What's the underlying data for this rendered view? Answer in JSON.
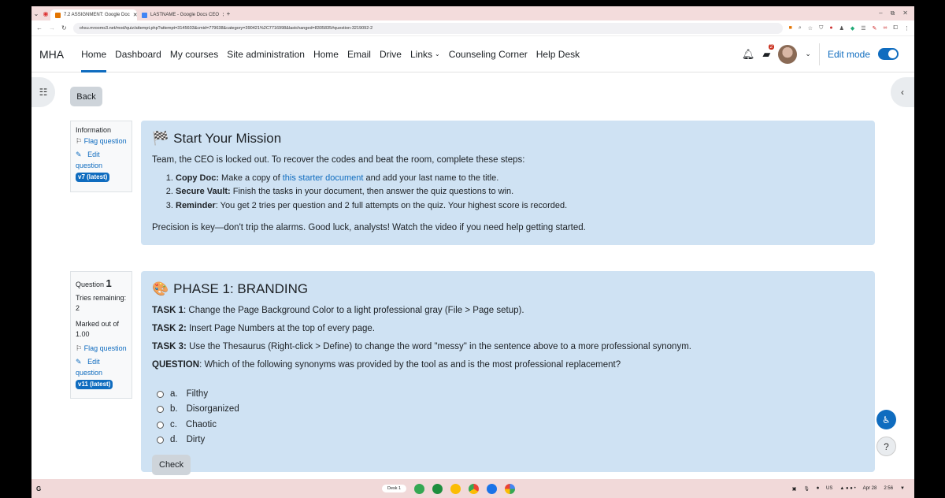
{
  "browser": {
    "tabs": [
      {
        "title": "7.2 ASSIGNMENT: Google Doc",
        "fav": "#e37400",
        "active": true
      },
      {
        "title": "LASTNAME - Google Docs CEO",
        "fav": "#4285f4",
        "active": false
      }
    ],
    "url": "ohsu.mrooms3.net/mod/quiz/attempt.php?attempt=3145603&cmid=779638&category=390421%2C7716998&lastchanged=8305835#question-3219092-2"
  },
  "nav": {
    "brand": "MHA",
    "links": [
      "Home",
      "Dashboard",
      "My courses",
      "Site administration",
      "Home",
      "Email",
      "Drive",
      "Links",
      "Counseling Corner",
      "Help Desk"
    ],
    "messages_count": "2",
    "edit_mode_label": "Edit mode",
    "edit_mode_on": true
  },
  "back_label": "Back",
  "info_block": {
    "heading": "Information",
    "flag": "Flag question",
    "edit_1": "Edit",
    "edit_2": "question",
    "version": "v7 (latest)"
  },
  "mission": {
    "title": "Start Your Mission",
    "intro": "Team, the CEO is locked out. To recover the codes and beat the room, complete these steps:",
    "steps": [
      {
        "bold": "Copy Doc:",
        "pre": " Make a copy of ",
        "link": "this starter document",
        "post": " and add your last name to the title."
      },
      {
        "bold": "Secure Vault:",
        "text": " Finish the tasks in your document, then answer the quiz questions to win."
      },
      {
        "bold": "Reminder",
        "text": ": You get 2 tries per question and 2 full attempts on the quiz. Your highest score is recorded."
      }
    ],
    "closing": "Precision is key—don't trip the alarms. Good luck, analysts! Watch the video if you need help getting started."
  },
  "question_info": {
    "label": "Question",
    "number": "1",
    "tries_label": "Tries remaining:",
    "tries_value": "2",
    "marked_label": "Marked out of",
    "marked_value": "1.00",
    "flag": "Flag question",
    "edit_1": "Edit",
    "edit_2": "question",
    "version": "v11 (latest)"
  },
  "question": {
    "title": "PHASE 1: BRANDING",
    "tasks": [
      {
        "bold": "TASK 1",
        "text": ": Change the Page Background Color to a light professional gray (File > Page setup)."
      },
      {
        "bold": "TASK 2:",
        "text": " Insert Page Numbers at the top of every page."
      },
      {
        "bold": "TASK 3:",
        "text": " Use the Thesaurus (Right-click > Define) to change the word \"messy\" in the sentence above to a more professional synonym."
      },
      {
        "bold": "QUESTION",
        "text": ": Which of the following synonyms was provided by the tool as and is the most professional replacement?"
      }
    ],
    "options": [
      {
        "letter": "a.",
        "text": "Filthy"
      },
      {
        "letter": "b.",
        "text": "Disorganized"
      },
      {
        "letter": "c.",
        "text": "Chaotic"
      },
      {
        "letter": "d.",
        "text": "Dirty"
      }
    ],
    "check_label": "Check"
  },
  "shelf": {
    "desk_label": "Desk 1",
    "locale": "US",
    "date": "Apr 28",
    "time": "2:56"
  }
}
